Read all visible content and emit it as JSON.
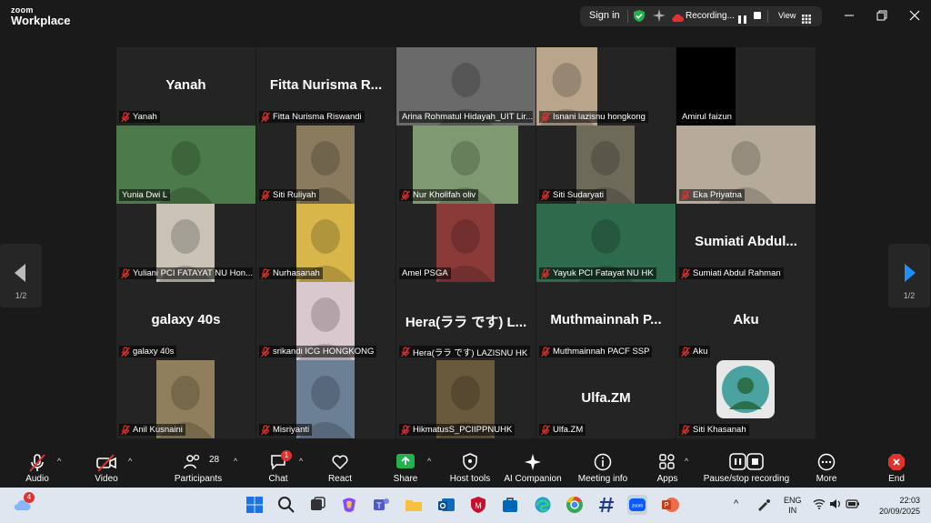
{
  "app": {
    "brand_top": "zoom",
    "brand_bottom": "Workplace"
  },
  "header": {
    "sign_in": "Sign in",
    "recording": "Recording...",
    "view": "View"
  },
  "gallery": {
    "page": "1/2",
    "tiles": [
      {
        "name": "Yanah",
        "display": "Yanah",
        "muted": true
      },
      {
        "name": "Fitta Nurisma Riswandi",
        "display": "Fitta  Nurisma  R...",
        "muted": true
      },
      {
        "name": "Arina Rohmatul Hidayah_UIT Lir...",
        "muted": false
      },
      {
        "name": "Isnani lazisnu hongkong",
        "muted": true
      },
      {
        "name": "Amirul faizun",
        "muted": false
      },
      {
        "name": "Yunia Dwi L",
        "muted": false,
        "active": true
      },
      {
        "name": "Siti Ruliyah",
        "muted": true
      },
      {
        "name": "Nur Kholifah oliv",
        "muted": true
      },
      {
        "name": "Siti Sudaryati",
        "muted": true
      },
      {
        "name": "Eka Priyatna",
        "muted": true
      },
      {
        "name": "Yuliani PCI FATAYAT NU Hon...",
        "muted": true
      },
      {
        "name": "Nurhasanah",
        "muted": true
      },
      {
        "name": "Amel PSGA",
        "muted": false
      },
      {
        "name": "Yayuk PCI Fatayat NU HK",
        "muted": true
      },
      {
        "name": "Sumiati Abdul Rahman",
        "display": "Sumiati  Abdul...",
        "muted": true
      },
      {
        "name": "galaxy 40s",
        "display": "galaxy 40s",
        "muted": true
      },
      {
        "name": "srikandi ICG HONGKONG",
        "muted": true
      },
      {
        "name": "Hera(ララ です) LAZISNU HK",
        "display": "Hera(ララ です) L...",
        "muted": true
      },
      {
        "name": "Muthmainnah PACF SSP",
        "display": "Muthmainnah  P...",
        "muted": true
      },
      {
        "name": "Aku",
        "display": "Aku",
        "muted": true
      },
      {
        "name": "Anil Kusnaini",
        "muted": true
      },
      {
        "name": "Misriyanti",
        "muted": true
      },
      {
        "name": "HikmatusS_PCIIPPNUHK",
        "muted": true
      },
      {
        "name": "Ulfa.ZM",
        "display": "Ulfa.ZM",
        "muted": true
      },
      {
        "name": "Siti Khasanah",
        "muted": true
      }
    ]
  },
  "toolbar": {
    "audio": "Audio",
    "video": "Video",
    "participants": "Participants",
    "participants_count": "28",
    "chat": "Chat",
    "chat_badge": "1",
    "react": "React",
    "share": "Share",
    "host_tools": "Host tools",
    "ai_companion": "AI Companion",
    "meeting_info": "Meeting info",
    "apps": "Apps",
    "pause_stop": "Pause/stop recording",
    "more": "More",
    "end": "End"
  },
  "taskbar": {
    "widgets_badge": "4",
    "lang1": "ENG",
    "lang2": "IN",
    "time": "22:03",
    "date": "20/09/2025"
  },
  "colors": {
    "active_border": "#3ddc84",
    "muted_red": "#e0332f",
    "end_red": "#e0332f",
    "share_green": "#22b14c",
    "nav_arrow": "#1e90ff"
  }
}
